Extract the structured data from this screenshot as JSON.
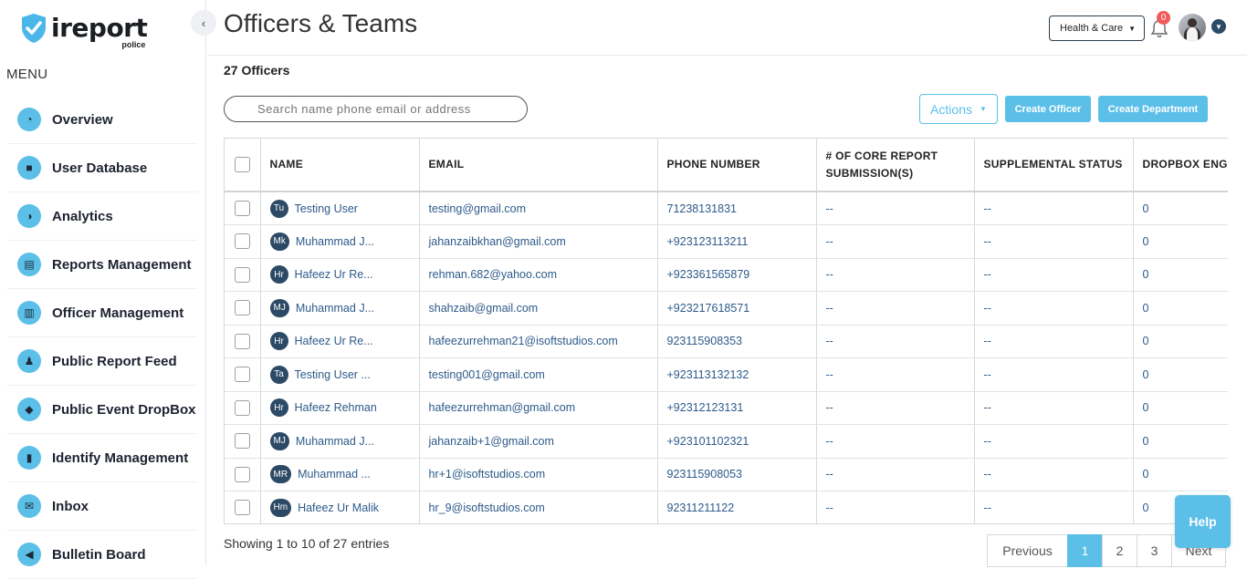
{
  "sidebar": {
    "brand": "ireport",
    "brand_sub": "police",
    "menu_title": "MENU",
    "items": [
      {
        "label": "Overview",
        "icon": "dashboard-icon"
      },
      {
        "label": "User Database",
        "icon": "database-icon"
      },
      {
        "label": "Analytics",
        "icon": "analytics-icon"
      },
      {
        "label": "Reports Management",
        "icon": "reports-icon"
      },
      {
        "label": "Officer Management",
        "icon": "officer-icon"
      },
      {
        "label": "Public Report Feed",
        "icon": "feed-icon"
      },
      {
        "label": "Public Event DropBox",
        "icon": "dropbox-icon"
      },
      {
        "label": "Identify Management",
        "icon": "identify-icon"
      },
      {
        "label": "Inbox",
        "icon": "inbox-icon"
      },
      {
        "label": "Bulletin Board",
        "icon": "megaphone-icon"
      }
    ]
  },
  "header": {
    "title": "Officers & Teams",
    "org_select": "Health & Care",
    "notification_count": "0"
  },
  "main": {
    "count_label": "27 Officers",
    "search_placeholder": "Search name phone email or address",
    "actions_label": "Actions",
    "create_officer_label": "Create Officer",
    "create_department_label": "Create Department",
    "columns": [
      "NAME",
      "EMAIL",
      "PHONE NUMBER",
      "# OF CORE REPORT SUBMISSION(S)",
      "SUPPLEMENTAL STATUS",
      "DROPBOX ENG"
    ],
    "rows": [
      {
        "initials": "Tu",
        "name": "Testing User",
        "email": "testing@gmail.com",
        "phone": "71238131831",
        "core": "--",
        "supp": "--",
        "dropbox": "0"
      },
      {
        "initials": "Mk",
        "name": "Muhammad J...",
        "email": "jahanzaibkhan@gmail.com",
        "phone": "+923123113211",
        "core": "--",
        "supp": "--",
        "dropbox": "0"
      },
      {
        "initials": "Hr",
        "name": "Hafeez Ur Re...",
        "email": "rehman.682@yahoo.com",
        "phone": "+923361565879",
        "core": "--",
        "supp": "--",
        "dropbox": "0"
      },
      {
        "initials": "MJ",
        "name": "Muhammad J...",
        "email": "shahzaib@gmail.com",
        "phone": "+923217618571",
        "core": "--",
        "supp": "--",
        "dropbox": "0"
      },
      {
        "initials": "Hr",
        "name": "Hafeez Ur Re...",
        "email": "hafeezurrehman21@isoftstudios.com",
        "phone": "923115908353",
        "core": "--",
        "supp": "--",
        "dropbox": "0"
      },
      {
        "initials": "Ta",
        "name": "Testing User ...",
        "email": "testing001@gmail.com",
        "phone": "+923113132132",
        "core": "--",
        "supp": "--",
        "dropbox": "0"
      },
      {
        "initials": "Hr",
        "name": "Hafeez Rehman",
        "email": "hafeezurrehman@gmail.com",
        "phone": "+92312123131",
        "core": "--",
        "supp": "--",
        "dropbox": "0"
      },
      {
        "initials": "MJ",
        "name": "Muhammad J...",
        "email": "jahanzaib+1@gmail.com",
        "phone": "+923101102321",
        "core": "--",
        "supp": "--",
        "dropbox": "0"
      },
      {
        "initials": "MR",
        "name": "Muhammad ...",
        "email": "hr+1@isoftstudios.com",
        "phone": "923115908053",
        "core": "--",
        "supp": "--",
        "dropbox": "0"
      },
      {
        "initials": "Hm",
        "name": "Hafeez Ur Malik",
        "email": "hr_9@isoftstudios.com",
        "phone": "92311211122",
        "core": "--",
        "supp": "--",
        "dropbox": "0"
      }
    ],
    "entries_info": "Showing 1 to 10 of 27 entries"
  },
  "pagination": {
    "previous": "Previous",
    "pages": [
      "1",
      "2",
      "3"
    ],
    "active": "1",
    "next": "Next"
  },
  "help_label": "Help",
  "colors": {
    "accent": "#5bbfe8",
    "dark": "#2c4a66",
    "badge": "#f05a5a"
  }
}
